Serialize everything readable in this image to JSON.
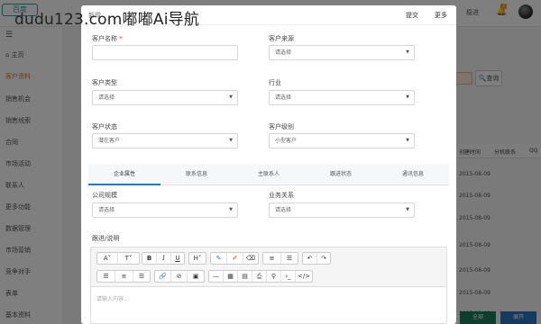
{
  "app": {
    "logo_text": "百度",
    "watermark": "dudu123.com嘟嘟Ai导航",
    "top_msg": "稳进",
    "bell_count": "2"
  },
  "sidebar": {
    "items": [
      {
        "label": "主页",
        "active": false
      },
      {
        "label": "客户资料",
        "active": true
      },
      {
        "label": "销售机会",
        "active": false
      },
      {
        "label": "销售线索",
        "active": false
      },
      {
        "label": "合同",
        "active": false
      },
      {
        "label": "市场活动",
        "active": false
      },
      {
        "label": "联系人",
        "active": false
      },
      {
        "label": "更多功能",
        "active": false
      },
      {
        "label": "数据管理",
        "active": false
      },
      {
        "label": "市场营销",
        "active": false
      },
      {
        "label": "竞争对手",
        "active": false
      },
      {
        "label": "表单",
        "active": false
      },
      {
        "label": "基本资料",
        "active": false
      }
    ]
  },
  "background": {
    "query_label": "查询",
    "columns": [
      "创建时间",
      "分机联系",
      "QQ"
    ],
    "dates": [
      "2015-08-09",
      "2015-08-09",
      "2015-08-09",
      "2015-08-09",
      "2015-08-09",
      "2015-08-09",
      "2015-08-09"
    ],
    "btn_green": "全部",
    "btn_blue": "展开"
  },
  "modal": {
    "title": "新增",
    "submit_label": "提交",
    "more_label": "更多",
    "fields": {
      "customer_name": {
        "label": "客户名称",
        "required": "*",
        "value": ""
      },
      "customer_source": {
        "label": "客户来源",
        "value": "请选择"
      },
      "customer_type": {
        "label": "客户类型",
        "value": "请选择"
      },
      "industry": {
        "label": "行业",
        "value": "请选择"
      },
      "customer_status": {
        "label": "客户状态",
        "value": "潜在客户"
      },
      "customer_level": {
        "label": "客户级别",
        "value": "小型客户"
      },
      "company_size": {
        "label": "公司规模",
        "value": "请选择"
      },
      "business_relation": {
        "label": "业务关系",
        "value": "请选择"
      }
    },
    "tabs": [
      "企业属性",
      "联系信息",
      "主联系人",
      "跟进状态",
      "通讯信息"
    ],
    "active_tab": 0,
    "notes_label": "跟进/说明",
    "editor_placeholder": "请输入内容..."
  }
}
